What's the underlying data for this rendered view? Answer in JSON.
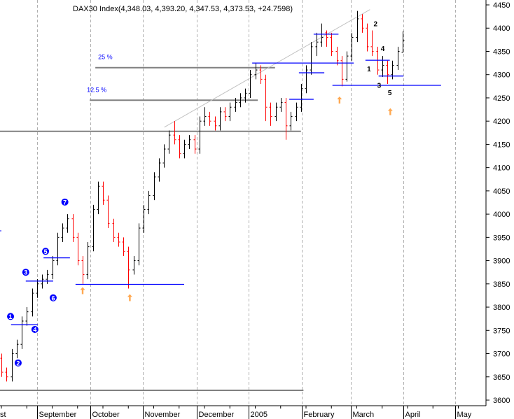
{
  "chart_data": {
    "type": "ohlc",
    "title": "DAX30 Index(4,348.03, 4,393.20, 4,347.53, 4,373.53, +24.7598)",
    "ylim": [
      3585,
      4460
    ],
    "yticks": [
      3600,
      3650,
      3700,
      3750,
      3800,
      3850,
      3900,
      3950,
      4000,
      4050,
      4100,
      4150,
      4200,
      4250,
      4300,
      4350,
      4400,
      4450
    ],
    "xticks": [
      {
        "label": "st",
        "bar": 0
      },
      {
        "label": "September",
        "bar": 7
      },
      {
        "label": "October",
        "bar": 17.5
      },
      {
        "label": "November",
        "bar": 27.8
      },
      {
        "label": "December",
        "bar": 38.5
      },
      {
        "label": "2005",
        "bar": 48.7
      },
      {
        "label": "February",
        "bar": 59.2
      },
      {
        "label": "March",
        "bar": 68.8
      },
      {
        "label": "April",
        "bar": 79.2
      },
      {
        "label": "May",
        "bar": 89.4
      }
    ],
    "grid": true,
    "colors": {
      "up": "#000000",
      "down": "#ff0000",
      "levels": "#0000ff",
      "support": "#808080",
      "arrows": "#ffa850",
      "trend": "#c0c0c0"
    },
    "bars_ohlc": [
      [
        3690,
        3700,
        3650,
        3660
      ],
      [
        3660,
        3670,
        3640,
        3650
      ],
      [
        3650,
        3710,
        3640,
        3700
      ],
      [
        3700,
        3730,
        3690,
        3720
      ],
      [
        3720,
        3780,
        3710,
        3770
      ],
      [
        3770,
        3800,
        3760,
        3790
      ],
      [
        3790,
        3840,
        3780,
        3830
      ],
      [
        3830,
        3860,
        3820,
        3850
      ],
      [
        3850,
        3870,
        3840,
        3860
      ],
      [
        3860,
        3880,
        3850,
        3870
      ],
      [
        3870,
        3910,
        3860,
        3900
      ],
      [
        3900,
        3960,
        3890,
        3950
      ],
      [
        3950,
        3980,
        3940,
        3970
      ],
      [
        3970,
        4000,
        3960,
        3990
      ],
      [
        3990,
        4000,
        3940,
        3950
      ],
      [
        3950,
        3960,
        3890,
        3900
      ],
      [
        3900,
        3910,
        3850,
        3870
      ],
      [
        3870,
        3940,
        3860,
        3930
      ],
      [
        3930,
        4020,
        3920,
        4010
      ],
      [
        4010,
        4070,
        4000,
        4060
      ],
      [
        4060,
        4070,
        4020,
        4030
      ],
      [
        4030,
        4040,
        3970,
        3980
      ],
      [
        3980,
        3990,
        3940,
        3950
      ],
      [
        3950,
        3960,
        3930,
        3940
      ],
      [
        3940,
        3950,
        3910,
        3920
      ],
      [
        3920,
        3930,
        3840,
        3880
      ],
      [
        3880,
        3910,
        3870,
        3900
      ],
      [
        3900,
        3980,
        3890,
        3970
      ],
      [
        3970,
        4020,
        3960,
        4010
      ],
      [
        4010,
        4050,
        4000,
        4040
      ],
      [
        4040,
        4090,
        4030,
        4080
      ],
      [
        4080,
        4120,
        4070,
        4110
      ],
      [
        4110,
        4150,
        4100,
        4140
      ],
      [
        4140,
        4180,
        4130,
        4170
      ],
      [
        4170,
        4200,
        4150,
        4160
      ],
      [
        4160,
        4170,
        4120,
        4130
      ],
      [
        4130,
        4160,
        4120,
        4150
      ],
      [
        4150,
        4170,
        4140,
        4160
      ],
      [
        4160,
        4170,
        4130,
        4140
      ],
      [
        4140,
        4210,
        4130,
        4200
      ],
      [
        4200,
        4230,
        4190,
        4210
      ],
      [
        4210,
        4220,
        4190,
        4200
      ],
      [
        4200,
        4210,
        4180,
        4190
      ],
      [
        4190,
        4230,
        4180,
        4220
      ],
      [
        4220,
        4230,
        4200,
        4210
      ],
      [
        4210,
        4240,
        4200,
        4230
      ],
      [
        4230,
        4250,
        4220,
        4240
      ],
      [
        4240,
        4260,
        4230,
        4250
      ],
      [
        4250,
        4270,
        4240,
        4260
      ],
      [
        4260,
        4310,
        4250,
        4300
      ],
      [
        4300,
        4325,
        4290,
        4310
      ],
      [
        4310,
        4320,
        4280,
        4290
      ],
      [
        4290,
        4300,
        4200,
        4230
      ],
      [
        4230,
        4240,
        4190,
        4210
      ],
      [
        4210,
        4240,
        4200,
        4230
      ],
      [
        4230,
        4250,
        4220,
        4240
      ],
      [
        4240,
        4250,
        4160,
        4190
      ],
      [
        4190,
        4220,
        4180,
        4210
      ],
      [
        4210,
        4240,
        4200,
        4230
      ],
      [
        4230,
        4280,
        4220,
        4270
      ],
      [
        4270,
        4320,
        4260,
        4310
      ],
      [
        4310,
        4370,
        4300,
        4360
      ],
      [
        4360,
        4390,
        4340,
        4370
      ],
      [
        4370,
        4410,
        4360,
        4380
      ],
      [
        4390,
        4395,
        4360,
        4380
      ],
      [
        4380,
        4390,
        4340,
        4350
      ],
      [
        4350,
        4360,
        4320,
        4330
      ],
      [
        4330,
        4340,
        4275,
        4290
      ],
      [
        4290,
        4350,
        4285,
        4340
      ],
      [
        4340,
        4390,
        4330,
        4380
      ],
      [
        4380,
        4437,
        4370,
        4420
      ],
      [
        4420,
        4430,
        4390,
        4400
      ],
      [
        4400,
        4410,
        4350,
        4360
      ],
      [
        4360,
        4395,
        4340,
        4350
      ],
      [
        4350,
        4360,
        4300,
        4310
      ],
      [
        4310,
        4340,
        4295,
        4320
      ],
      [
        4320,
        4330,
        4280,
        4300
      ],
      [
        4300,
        4330,
        4290,
        4320
      ],
      [
        4320,
        4360,
        4310,
        4350
      ],
      [
        4348.03,
        4393.2,
        4347.53,
        4373.53
      ]
    ],
    "support_lines": [
      {
        "value": 4315,
        "from_bar": 18.5,
        "to_bar": 53.9,
        "label": "25 %"
      },
      {
        "value": 4245,
        "from_bar": 17.4,
        "to_bar": 50.5,
        "label": "12.5 %"
      },
      {
        "value": 4178,
        "from_bar": -0.3,
        "to_bar": 59,
        "label": ""
      },
      {
        "value": 3621,
        "from_bar": -0.3,
        "to_bar": 59.5,
        "label": ""
      }
    ],
    "level_lines": [
      {
        "value": 4325,
        "from_bar": 49.4,
        "to_bar": 69.4
      },
      {
        "value": 4304,
        "from_bar": 58.6,
        "to_bar": 63.6
      },
      {
        "value": 4247,
        "from_bar": 56.7,
        "to_bar": 61.5
      },
      {
        "value": 4387,
        "from_bar": 61.5,
        "to_bar": 66.4
      },
      {
        "value": 4277,
        "from_bar": 65.2,
        "to_bar": 86.6
      },
      {
        "value": 4331,
        "from_bar": 71.7,
        "to_bar": 76.5
      },
      {
        "value": 4297,
        "from_bar": 74.3,
        "to_bar": 79.2
      },
      {
        "value": 3849,
        "from_bar": 14.6,
        "to_bar": 36
      },
      {
        "value": 3906,
        "from_bar": 8.3,
        "to_bar": 13.5
      },
      {
        "value": 3856,
        "from_bar": 4.8,
        "to_bar": 10.2
      },
      {
        "value": 3762,
        "from_bar": 1.9,
        "to_bar": 7.2
      }
    ],
    "trendline": {
      "from": {
        "bar": 32.1,
        "value": 4187
      },
      "to": {
        "bar": 72.6,
        "value": 4440
      }
    },
    "wave_markers": [
      {
        "label": "1",
        "bar": 1.8,
        "value": 3780
      },
      {
        "label": "2",
        "bar": 3.3,
        "value": 3680
      },
      {
        "label": "3",
        "bar": 4.8,
        "value": 3875
      },
      {
        "label": "4",
        "bar": 6.6,
        "value": 3752
      },
      {
        "label": "5",
        "bar": 8.7,
        "value": 3920
      },
      {
        "label": "6",
        "bar": 10.2,
        "value": 3820
      },
      {
        "label": "7",
        "bar": 12.5,
        "value": 4026
      }
    ],
    "wave_labels": [
      {
        "label": "2",
        "bar": 73.7,
        "value": 4410
      },
      {
        "label": "4",
        "bar": 75.1,
        "value": 4357
      },
      {
        "label": "1",
        "bar": 72.4,
        "value": 4313
      },
      {
        "label": "3",
        "bar": 74.4,
        "value": 4278
      },
      {
        "label": "5",
        "bar": 76.5,
        "value": 4262
      }
    ],
    "arrows": [
      {
        "bar": 16,
        "value": 3843
      },
      {
        "bar": 25.3,
        "value": 3828
      },
      {
        "bar": 66.6,
        "value": 4253
      },
      {
        "bar": 76.6,
        "value": 4228
      }
    ]
  }
}
